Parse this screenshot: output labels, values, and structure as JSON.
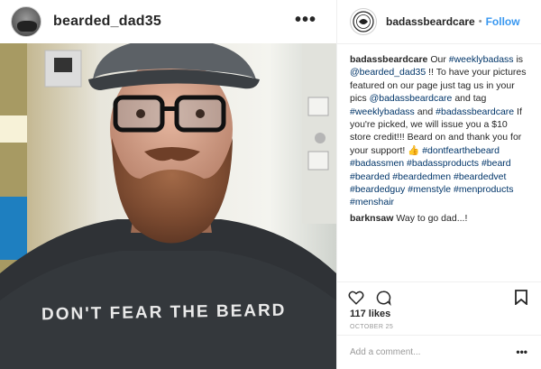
{
  "post": {
    "username": "bearded_dad35",
    "shirt_text": "DON'T FEAR THE BEARD"
  },
  "sidebar": {
    "account": "badassbeardcare",
    "dot": "•",
    "follow_label": "Follow",
    "caption": {
      "parts": [
        {
          "t": "Our ",
          "h": false
        },
        {
          "t": "#weeklybadass",
          "h": true
        },
        {
          "t": " is ",
          "h": false
        },
        {
          "t": "@bearded_dad35",
          "h": true
        },
        {
          "t": " !! To have your pictures featured on our page just tag us in your pics ",
          "h": false
        },
        {
          "t": "@badassbeardcare",
          "h": true
        },
        {
          "t": " and tag ",
          "h": false
        },
        {
          "t": "#weeklybadass",
          "h": true
        },
        {
          "t": " and ",
          "h": false
        },
        {
          "t": "#badassbeardcare",
          "h": true
        },
        {
          "t": " If you're picked, we will issue you a $10 store credit!!! Beard on and thank you for your support! 👍 ",
          "h": false
        },
        {
          "t": "#dontfearthebeard",
          "h": true
        },
        {
          "t": " ",
          "h": false
        },
        {
          "t": "#badassmen",
          "h": true
        },
        {
          "t": " ",
          "h": false
        },
        {
          "t": "#badassproducts",
          "h": true
        },
        {
          "t": " ",
          "h": false
        },
        {
          "t": "#beard",
          "h": true
        },
        {
          "t": " ",
          "h": false
        },
        {
          "t": "#bearded",
          "h": true
        },
        {
          "t": " ",
          "h": false
        },
        {
          "t": "#beardedmen",
          "h": true
        },
        {
          "t": " ",
          "h": false
        },
        {
          "t": "#beardedvet",
          "h": true
        },
        {
          "t": " ",
          "h": false
        },
        {
          "t": "#beardedguy",
          "h": true
        },
        {
          "t": " ",
          "h": false
        },
        {
          "t": "#menstyle",
          "h": true
        },
        {
          "t": " ",
          "h": false
        },
        {
          "t": "#menproducts",
          "h": true
        },
        {
          "t": " ",
          "h": false
        },
        {
          "t": "#menshair",
          "h": true
        }
      ]
    },
    "comment": {
      "user": "barknsaw",
      "text": "Way to go dad...!"
    },
    "likes": "117 likes",
    "date": "OCTOBER 25",
    "add_comment_placeholder": "Add a comment...",
    "more_glyph": "•••",
    "colors": {
      "link": "#3897f0",
      "hashtag": "#003569",
      "muted": "#999999"
    }
  },
  "icons": [
    "more-options-icon",
    "heart-icon",
    "comment-icon",
    "bookmark-icon",
    "account-avatar-icon"
  ]
}
